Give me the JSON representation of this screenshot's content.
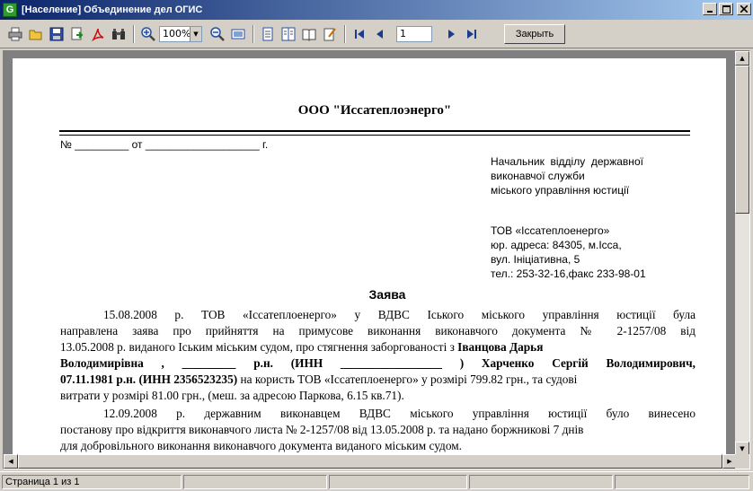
{
  "window": {
    "app_icon_letter": "G",
    "title": "[Население] Объединение дел ОГИС"
  },
  "toolbar": {
    "zoom_value": "100%",
    "page_number": "1",
    "close_label": "Закрыть"
  },
  "document": {
    "company": "ООО \"Иссатеплоэнерго\"",
    "number_line": "№ _________ от ___________________ г.",
    "recipient": [
      "Начальник  відділу  державної",
      "виконавчої служби",
      "міського управління юстиції"
    ],
    "sender": [
      "ТОВ «Іссатеплоенерго»",
      "юр. адреса: 84305, м.Ісса,",
      "вул. Ініціативна, 5",
      "тел.: 253-32-16,факс 233-98-01"
    ],
    "title": "Заява",
    "paragraph1": {
      "l1": "15.08.2008 р. ТОВ «Іссатеплоенерго» у ВДВС Іського міського управління юстиції  була",
      "l2": "направлена заява про прийняття на  примусове виконання  виконавчого документа № 2-1257/08 від",
      "l3a": "13.05.2008 р. виданого Іським міським судом, про стягнення заборгованості з ",
      "l3b": "Іванцова Дарья",
      "l4": "Володимирівна ,  _________ р.н. (ИНН _________________ )   Харченко Сергій Володимирович,",
      "l5a": "07.11.1981 р.н.  (ИНН 2356523235)",
      "l5b": "  на користь ТОВ «Іссатеплоенерго» у розмірі 799.82 грн., та судові",
      "l6": "витрати у розмірі 81.00  грн., (меш. за адресою   Паркова, 6.15 кв.71)."
    },
    "paragraph2": {
      "l1": "12.09.2008 р. державним виконавцем ВДВС міського управління юстиції було винесено",
      "l2": "постанову про відкриття виконавчого листа № 2-1257/08 від 13.05.2008 р.  та надано боржникові 7 днів",
      "l3": "для добровільного  виконання виконавчого документа виданого міським судом."
    }
  },
  "statusbar": {
    "page_info": "Страница 1 из 1"
  }
}
